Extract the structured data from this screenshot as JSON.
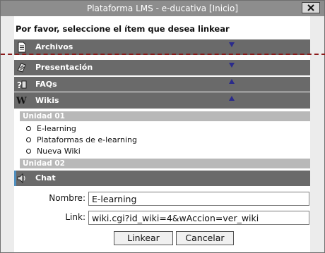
{
  "window": {
    "title": "Plataforma LMS - e-ducativa [Inicio]",
    "close_icon": "close-x-icon"
  },
  "prompt": "Por favor, seleccione el ítem que desea linkear",
  "sections": [
    {
      "label": "Archivos",
      "icon": "document-icon",
      "expanded": false
    },
    {
      "label": "Presentación",
      "icon": "presentation-icon",
      "expanded": false
    },
    {
      "label": "FAQs",
      "icon": "faq-icon",
      "expanded": false
    },
    {
      "label": "Wikis",
      "icon": "wiki-icon",
      "expanded": true
    },
    {
      "label": "Chat",
      "icon": "chat-speaker-icon",
      "expanded": false
    }
  ],
  "wikis": {
    "units": [
      {
        "label": "Unidad 01",
        "items": [
          "E-learning",
          "Plataformas de e-learning",
          "Nueva Wiki"
        ]
      },
      {
        "label": "Unidad 02",
        "items": []
      }
    ]
  },
  "form": {
    "nombre_label": "Nombre:",
    "nombre_value": "E-learning",
    "link_label": "Link:",
    "link_value": "wiki.cgi?id_wiki=4&wAccion=ver_wiki",
    "ok_label": "Linkear",
    "cancel_label": "Cancelar"
  },
  "colors": {
    "bar": "#6a6a6a",
    "unit_header": "#b8b8b8",
    "arrow": "#2a2a8c",
    "dashed_line": "#8b1a1a"
  }
}
